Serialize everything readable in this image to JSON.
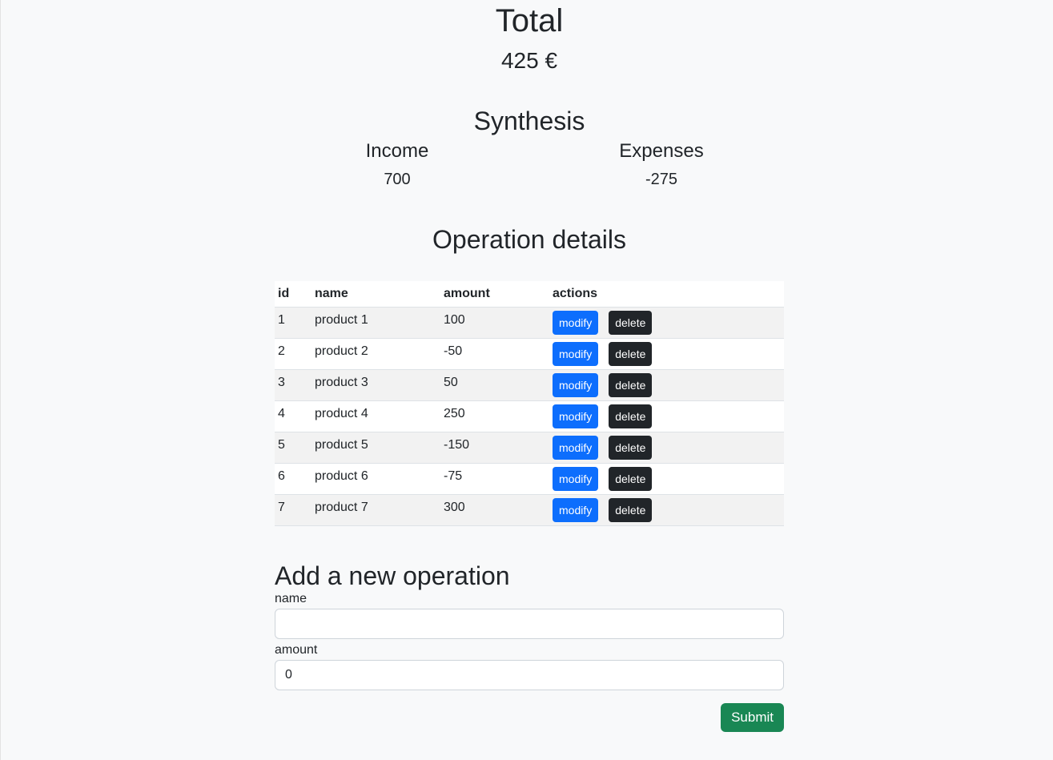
{
  "total": {
    "title": "Total",
    "value": "425 €"
  },
  "synthesis": {
    "title": "Synthesis",
    "income_label": "Income",
    "income_value": "700",
    "expenses_label": "Expenses",
    "expenses_value": "-275"
  },
  "operations": {
    "title": "Operation details",
    "columns": [
      "id",
      "name",
      "amount",
      "actions"
    ],
    "modify_label": "modify",
    "delete_label": "delete",
    "rows": [
      {
        "id": "1",
        "name": "product 1",
        "amount": "100"
      },
      {
        "id": "2",
        "name": "product 2",
        "amount": "-50"
      },
      {
        "id": "3",
        "name": "product 3",
        "amount": "50"
      },
      {
        "id": "4",
        "name": "product 4",
        "amount": "250"
      },
      {
        "id": "5",
        "name": "product 5",
        "amount": "-150"
      },
      {
        "id": "6",
        "name": "product 6",
        "amount": "-75"
      },
      {
        "id": "7",
        "name": "product 7",
        "amount": "300"
      }
    ]
  },
  "form": {
    "title": "Add a new operation",
    "name_label": "name",
    "name_value": "",
    "amount_label": "amount",
    "amount_value": "0",
    "submit_label": "Submit"
  },
  "colors": {
    "primary": "#0d6efd",
    "dark": "#212529",
    "success": "#198754",
    "background": "#f8f9fa"
  }
}
